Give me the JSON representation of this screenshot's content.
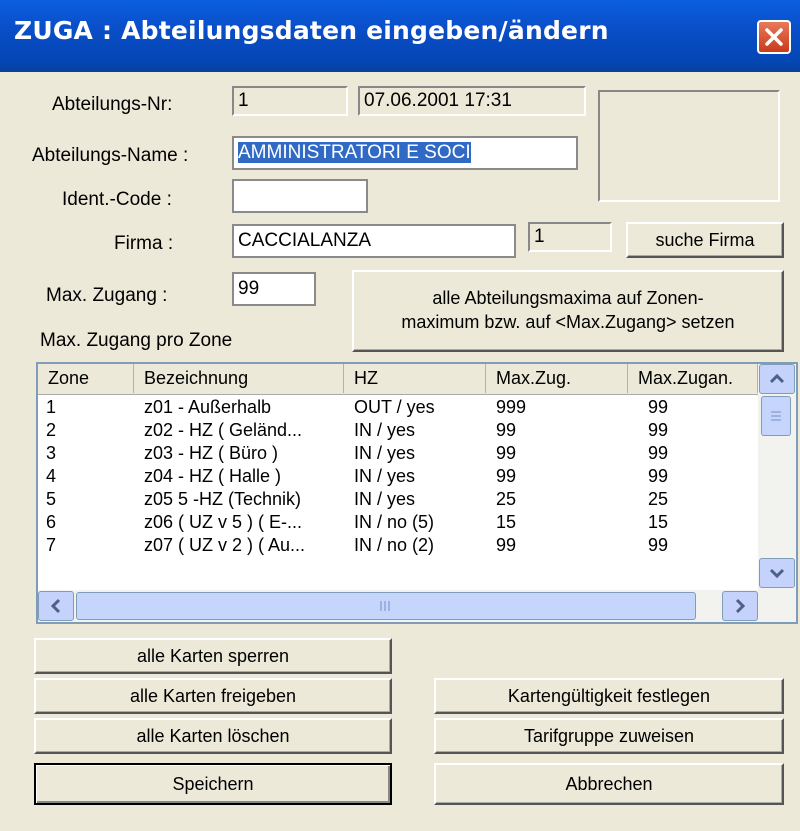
{
  "window": {
    "title": "ZUGA : Abteilungsdaten eingeben/ändern"
  },
  "form": {
    "abteilungs_nr_label": "Abteilungs-Nr:",
    "abteilungs_nr_value": "1",
    "timestamp": "07.06.2001 17:31",
    "abteilungs_name_label": "Abteilungs-Name :",
    "abteilungs_name_value": "AMMINISTRATORI E SOCI",
    "ident_code_label": "Ident.-Code :",
    "ident_code_value": "",
    "firma_label": "Firma :",
    "firma_value": "CACCIALANZA",
    "firma_nr": "1",
    "suche_firma_label": "suche Firma",
    "max_zugang_label": "Max. Zugang :",
    "max_zugang_value": "99",
    "set_maxima_label_1": "alle Abteilungsmaxima auf Zonen-",
    "set_maxima_label_2": "maximum bzw. auf <Max.Zugang> setzen",
    "zone_list_label": "Max. Zugang pro Zone"
  },
  "table": {
    "columns": [
      "Zone",
      "Bezeichnung",
      "HZ",
      "Max.Zug.",
      "Max.Zugan."
    ],
    "rows": [
      [
        "1",
        "z01 - Außerhalb",
        "OUT / yes",
        "999",
        "99"
      ],
      [
        "2",
        "z02 - HZ  ( Geländ...",
        "IN / yes",
        "99",
        "99"
      ],
      [
        "3",
        "z03 - HZ  ( Büro )",
        "IN / yes",
        "99",
        "99"
      ],
      [
        "4",
        "z04 - HZ  ( Halle )",
        "IN / yes",
        "99",
        "99"
      ],
      [
        "5",
        "z05 5 -HZ  (Technik)",
        "IN / yes",
        "25",
        "25"
      ],
      [
        "6",
        "z06 ( UZ v 5 ) ( E-...",
        "IN / no (5)",
        "15",
        "15"
      ],
      [
        "7",
        "z07 ( UZ v 2 ) ( Au...",
        "IN / no (2)",
        "99",
        "99"
      ]
    ]
  },
  "buttons": {
    "alle_karten_sperren": "alle Karten sperren",
    "alle_karten_freigeben": "alle Karten freigeben",
    "alle_karten_loeschen": "alle Karten löschen",
    "speichern": "Speichern",
    "kartengueltigkeit": "Kartengültigkeit festlegen",
    "tarifgruppe": "Tarifgruppe zuweisen",
    "abbrechen": "Abbrechen"
  }
}
